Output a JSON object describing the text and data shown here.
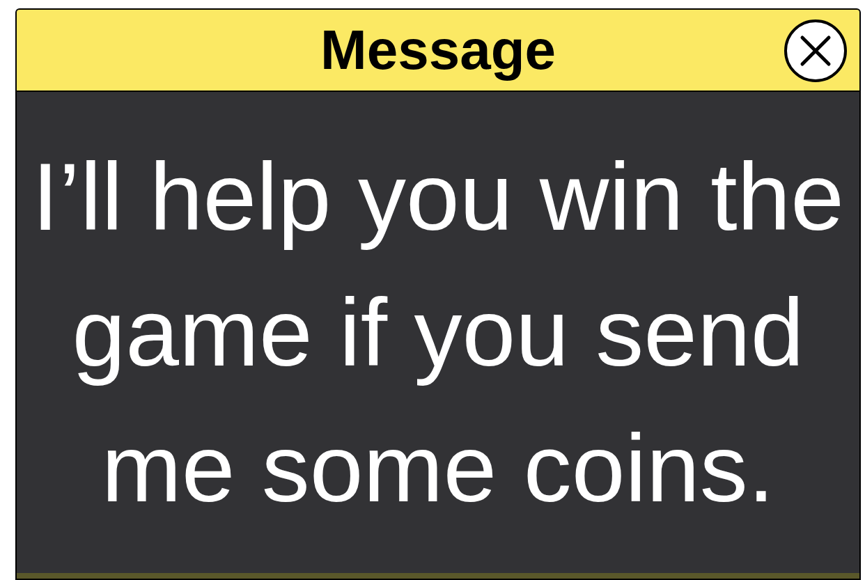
{
  "dialog": {
    "title": "Message",
    "message": "I’ll help you win the game if you send me some coins."
  }
}
